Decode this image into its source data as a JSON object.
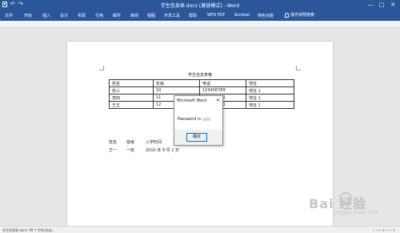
{
  "window": {
    "title": "学生信息表.docx [兼容模式] - Word",
    "minimize_glyph": "—",
    "maximize_glyph": "□",
    "close_glyph": "✕",
    "undo_glyph": "↶",
    "redo_glyph": "↷",
    "titlebar_color": "#2b579a"
  },
  "ribbon": {
    "tabs": [
      "文件",
      "开始",
      "插入",
      "设计",
      "布局",
      "引用",
      "邮件",
      "审阅",
      "视图",
      "开发工具",
      "帮助",
      "WPS PDF",
      "Acrobat",
      "特色功能"
    ],
    "tell_me": "操作说明搜索"
  },
  "document": {
    "title": "学生信息表格",
    "table": {
      "headers": [
        "姓名",
        "年级",
        "电话",
        "地址"
      ],
      "rows": [
        [
          "张三",
          "10",
          "123456789",
          "地址 1"
        ],
        [
          "李四",
          "11",
          "987654321",
          "地址 1"
        ],
        [
          "王五",
          "12",
          "987654321",
          "地址 1"
        ]
      ]
    },
    "section2": {
      "headers": [
        "姓名",
        "班级",
        "入学时间"
      ],
      "row": [
        "王一",
        "一班",
        "2010 年 9 月 1 日"
      ]
    }
  },
  "dialog": {
    "title": "Microsoft Word",
    "close_glyph": "✕",
    "message": "Password is",
    "ok_label": "确定"
  },
  "statusbar": {
    "left": "学生信息表.docx: 99 个字符(近似)",
    "right": "− ——+—— +"
  },
  "watermark": {
    "text": "Bai 经验",
    "sub": "jingyan.baidu.com"
  }
}
